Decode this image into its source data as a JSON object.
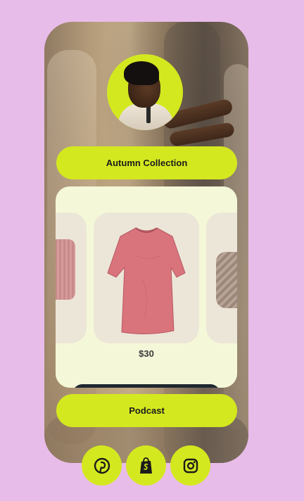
{
  "profile": {
    "avatar_icon": "profile-photo"
  },
  "links": [
    {
      "label": "Autumn Collection"
    },
    {
      "label": "Podcast"
    }
  ],
  "carousel": {
    "items": [
      {
        "product_icon": "pink-beanie-icon"
      },
      {
        "product_icon": "pink-tshirt-icon",
        "price": "$30"
      },
      {
        "product_icon": "knit-hat-icon"
      }
    ]
  },
  "socials": [
    {
      "icon": "pinterest-icon"
    },
    {
      "icon": "shopify-icon"
    },
    {
      "icon": "instagram-icon"
    }
  ],
  "colors": {
    "background": "#e8bce9",
    "accent": "#d4e81f",
    "card": "#f4f8d8",
    "tile": "#ece6d8",
    "text": "#1b1b1b"
  }
}
